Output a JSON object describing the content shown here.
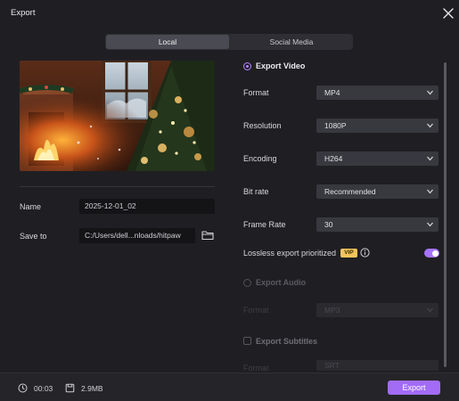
{
  "window": {
    "title": "Export"
  },
  "tabs": [
    {
      "label": "Local",
      "active": true
    },
    {
      "label": "Social Media",
      "active": false
    }
  ],
  "left": {
    "name_label": "Name",
    "name_value": "2025-12-01_02",
    "save_label": "Save to",
    "save_value": "C:/Users/dell...nloads/hitpaw"
  },
  "video": {
    "title": "Export Video",
    "enabled": true,
    "rows": [
      {
        "label": "Format",
        "value": "MP4"
      },
      {
        "label": "Resolution",
        "value": "1080P"
      },
      {
        "label": "Encoding",
        "value": "H264"
      },
      {
        "label": "Bit rate",
        "value": "Recommended"
      },
      {
        "label": "Frame Rate",
        "value": "30"
      }
    ],
    "lossless_label": "Lossless export prioritized",
    "vip_badge": "VIP",
    "lossless_on": true
  },
  "audio": {
    "title": "Export Audio",
    "enabled": false,
    "format_label": "Format",
    "format_value": "MP3"
  },
  "subtitles": {
    "title": "Export Subtitles",
    "checked": false,
    "format_label": "Format",
    "format_value": "SRT"
  },
  "footer": {
    "duration": "00:03",
    "size": "2.9MB",
    "export_label": "Export"
  },
  "colors": {
    "accent": "#a26cf6",
    "vip": "#f3c45a",
    "background": "#1f1f23"
  }
}
